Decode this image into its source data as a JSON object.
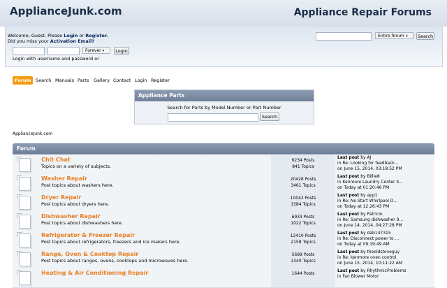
{
  "header": {
    "site_title": "ApplianceJunk.com",
    "forum_title": "Appliance Repair Forums"
  },
  "userbar": {
    "welcome_text": "Welcome, Guest. Please",
    "login_link": "Login",
    "or_text": "or",
    "register_link": "Register.",
    "activation_text": "Did you miss your",
    "activation_link": "Activation Email?",
    "duration_option": "Forever",
    "login_button": "Login",
    "login_hint": "Login with username and password or",
    "search_scope": "Entire forum",
    "search_button": "Search"
  },
  "nav": {
    "items": [
      "Forum",
      "Search",
      "Manuals",
      "Parts",
      "Gallery",
      "Contact",
      "Login",
      "Register"
    ]
  },
  "parts_panel": {
    "title": "Appliance Parts",
    "subtitle": "Search for Parts by Model Number or Part Number",
    "search_button": "Search"
  },
  "breadcrumb": "ApplianceJunk.com",
  "forum": {
    "header": "Forum",
    "boards": [
      {
        "name": "Chit Chat",
        "desc": "Topics on a variety of subjects.",
        "posts": "6234 Posts",
        "topics": "841 Topics",
        "last_by": "by AJ",
        "last_in": "in Re: Looking for feedback...",
        "last_on": "on June 15, 2014, 03:18:52 PM"
      },
      {
        "name": "Washer Repair",
        "desc": "Post topics about washers here.",
        "posts": "20426 Posts",
        "topics": "3461 Topics",
        "last_by": "by Billie8",
        "last_in": "in Kenmore Laundry Center 4...",
        "last_on": "on Today at 01:20:46 PM"
      },
      {
        "name": "Dryer Repair",
        "desc": "Post topics about dryers here.",
        "posts": "10042 Posts",
        "topics": "1584 Topics",
        "last_by": "by app1",
        "last_in": "in Re: No Start Whirlpool D...",
        "last_on": "on Today at 12:26:43 PM"
      },
      {
        "name": "Dishwasher Repair",
        "desc": "Post topics about dishwashers here.",
        "posts": "6933 Posts",
        "topics": "1022 Topics",
        "last_by": "by Patricio",
        "last_in": "in Re: Samsung dishwasher 9...",
        "last_on": "on June 14, 2014, 04:27:28 PM"
      },
      {
        "name": "Refrigerator & Freezer Repair",
        "desc": "Post topics about refrigerators, freezers and ice makers here.",
        "posts": "12410 Posts",
        "topics": "2158 Topics",
        "last_by": "by dab147315",
        "last_in": "in Re: Disconnect power to ...",
        "last_on": "on Today at 09:19:49 AM"
      },
      {
        "name": "Range, Oven & Cooktop Repair",
        "desc": "Post topics about ranges, ovens, cooktops and microwaves here.",
        "posts": "5699 Posts",
        "topics": "1340 Topics",
        "last_by": "by theoldstoveguy",
        "last_in": "in Re: kenmore oven control",
        "last_on": "on June 15, 2014, 10:11:22 AM"
      },
      {
        "name": "Heating & Air Conditioning Repair",
        "desc": "",
        "posts": "1644 Posts",
        "topics": "",
        "last_by": "by RhythmicProblems",
        "last_in": "in Fan Blower Motor",
        "last_on": ""
      }
    ],
    "last_post_label": "Last post"
  }
}
